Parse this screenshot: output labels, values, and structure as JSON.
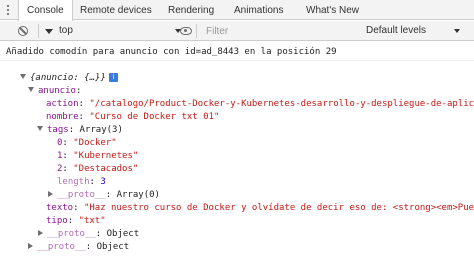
{
  "tabs": [
    {
      "label": "Console",
      "active": true
    },
    {
      "label": "Remote devices",
      "active": false
    },
    {
      "label": "Rendering",
      "active": false
    },
    {
      "label": "Animations",
      "active": false
    },
    {
      "label": "What's New",
      "active": false
    }
  ],
  "toolbar": {
    "context": "top",
    "filter_placeholder": "Filter",
    "levels": "Default levels"
  },
  "console": {
    "log_message": "Añadido comodín para anuncio con id=ad_8443 en la posición 29",
    "root_label": "{anuncio: {…}}",
    "info_badge": "i",
    "anuncio_key": "anuncio",
    "action_key": "action",
    "action_value": "\"/catalogo/Product-Docker-y-Kubernetes-desarrollo-y-despliegue-de-aplicac",
    "nombre_key": "nombre",
    "nombre_value": "\"Curso de Docker txt 01\"",
    "tags_key": "tags",
    "tags_summary": "Array(3)",
    "tags": [
      {
        "index": "0",
        "value": "\"Docker\""
      },
      {
        "index": "1",
        "value": "\"Kubernetes\""
      },
      {
        "index": "2",
        "value": "\"Destacados\""
      }
    ],
    "length_key": "length",
    "length_value": "3",
    "proto_key": "__proto__",
    "proto_array": "Array(0)",
    "texto_key": "texto",
    "texto_value": "\"Haz nuestro curso de Docker y olvídate de decir eso de: <strong><em>Pues",
    "tipo_key": "tipo",
    "tipo_value": "\"txt\"",
    "proto_object": "Object"
  }
}
